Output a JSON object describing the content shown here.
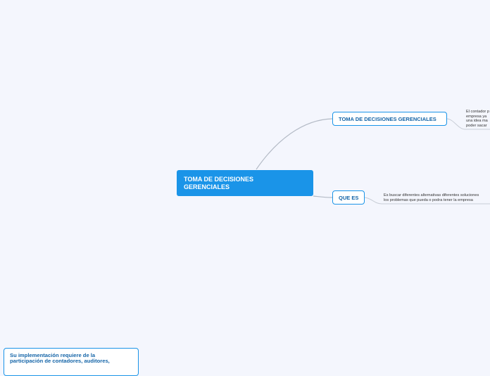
{
  "mindmap": {
    "central": {
      "lines": [
        "TOMA DE DECISIONES",
        "GERENCIALES"
      ]
    },
    "branches": [
      {
        "label": "TOMA DE DECISIONES GERENCIALES",
        "note_lines": [
          "El contador p",
          "empresa ya",
          "una idea ma",
          "poder sacar"
        ]
      },
      {
        "label": "QUE ES",
        "note_lines": [
          "Es buscar diferentes alternativas diferentes soluciones",
          "los problemas que pueda o podra tener la empresa"
        ]
      }
    ],
    "bottom_node": {
      "lines": [
        "Su implementación requiere de la",
        "participación de contadores, auditores,"
      ]
    }
  },
  "colors": {
    "background": "#f4f6fd",
    "accent": "#1a94e8",
    "node_text": "#1565a8",
    "connector": "#b4bbc6"
  }
}
